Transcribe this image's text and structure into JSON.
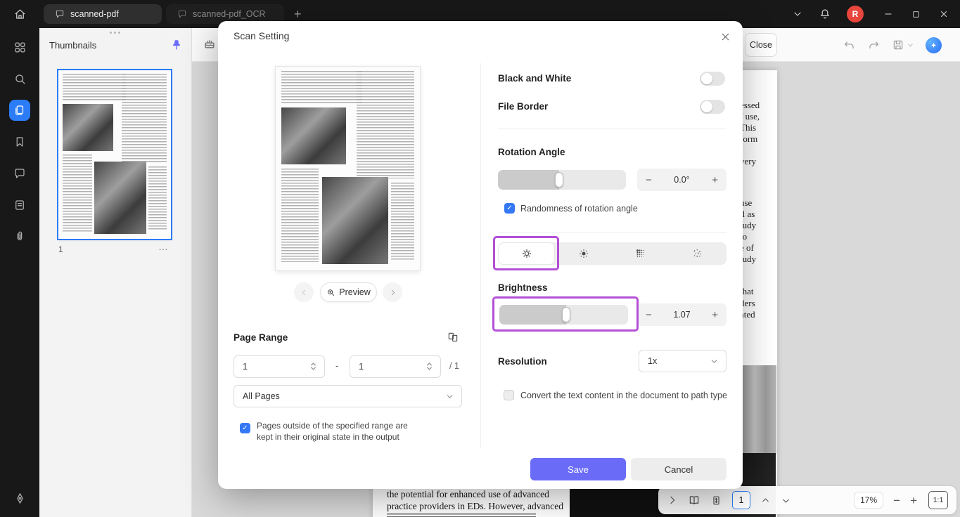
{
  "titlebar": {
    "tabs": [
      {
        "label": "scanned-pdf"
      },
      {
        "label": "scanned-pdf_OCR"
      }
    ],
    "avatar_initial": "R"
  },
  "thumbnails_panel": {
    "title": "Thumbnails",
    "page_number": "1",
    "more_label": "…"
  },
  "toolbar": {
    "close_label": "Close"
  },
  "modal": {
    "title": "Scan Setting",
    "preview": {
      "button_label": "Preview"
    },
    "page_range": {
      "title": "Page Range",
      "from": "1",
      "dash": "-",
      "to": "1",
      "total": "/ 1",
      "select_value": "All Pages",
      "note_line1": "Pages outside of the specified range are",
      "note_line2": "kept in their original state in the output"
    },
    "settings": {
      "black_and_white_label": "Black and White",
      "file_border_label": "File Border",
      "rotation_label": "Rotation Angle",
      "rotation_value": "0.0°",
      "randomness_label": "Randomness of rotation angle",
      "brightness_label": "Brightness",
      "brightness_value": "1.07",
      "resolution_label": "Resolution",
      "resolution_value": "1x",
      "convert_label": "Convert the text content in the document to path type",
      "minus": "−",
      "plus": "+"
    },
    "footer": {
      "save_label": "Save",
      "cancel_label": "Cancel"
    }
  },
  "document": {
    "edge_fragments": [
      "essed",
      "f use,",
      "This",
      "form",
      "very",
      "use",
      "ll as",
      "tudy",
      "to",
      "e of",
      "tudy",
      "that",
      "ders",
      "ated"
    ],
    "bottom_line1": "the potential for enhanced use of advanced",
    "bottom_line2": "practice providers in EDs. However, advanced"
  },
  "statusbar": {
    "page": "1",
    "zoom": "17%",
    "minus": "−",
    "plus": "+",
    "fit": "1:1"
  },
  "colors": {
    "accent_save": "#6a6cf8",
    "highlight_purple": "#b44fd6",
    "selection_blue": "#2b7cf6",
    "checkbox_blue": "#3478f6",
    "avatar_red": "#e8453c"
  }
}
